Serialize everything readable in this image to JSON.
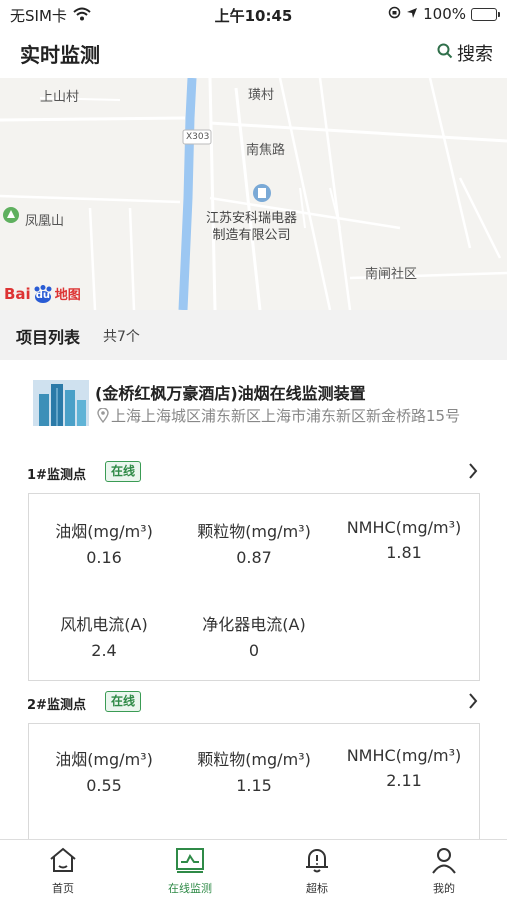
{
  "status_bar": {
    "carrier": "无SIM卡",
    "time": "上午10:45",
    "battery_percent": "100%",
    "battery_color": "#4cd964"
  },
  "nav": {
    "title": "实时监测",
    "search_label": "搜索",
    "search_icon": "search-icon"
  },
  "map": {
    "labels": {
      "shangshancun": "上山村",
      "huangcun": "璜村",
      "road_code": "X303",
      "nanjiao_road": "南焦路",
      "fenghuangshan": "凤凰山",
      "poi_line1": "江苏安科瑞电器",
      "poi_line2": "制造有限公司",
      "nanzha_community": "南闸社区"
    },
    "logo": {
      "bai": "Bai",
      "du": "du",
      "ditu": "地图"
    }
  },
  "project_list": {
    "title": "项目列表",
    "count": "共7个"
  },
  "project": {
    "name": "(金桥红枫万豪酒店)油烟在线监测装置",
    "address": "上海上海城区浦东新区上海市浦东新区新金桥路15号",
    "points": [
      {
        "name": "1#监测点",
        "status": "在线",
        "metrics": [
          {
            "label": "油烟(mg/m³)",
            "value": "0.16"
          },
          {
            "label": "颗粒物(mg/m³)",
            "value": "0.87"
          },
          {
            "label": "NMHC(mg/m³)",
            "value": "1.81"
          },
          {
            "label": "风机电流(A)",
            "value": "2.4"
          },
          {
            "label": "净化器电流(A)",
            "value": "0"
          }
        ]
      },
      {
        "name": "2#监测点",
        "status": "在线",
        "metrics": [
          {
            "label": "油烟(mg/m³)",
            "value": "0.55"
          },
          {
            "label": "颗粒物(mg/m³)",
            "value": "1.15"
          },
          {
            "label": "NMHC(mg/m³)",
            "value": "2.11"
          }
        ]
      }
    ]
  },
  "tabbar": {
    "items": [
      {
        "label": "首页",
        "icon": "home-icon"
      },
      {
        "label": "在线监测",
        "icon": "monitor-icon",
        "active": true
      },
      {
        "label": "超标",
        "icon": "alarm-bell-icon"
      },
      {
        "label": "我的",
        "icon": "user-icon"
      }
    ],
    "active_color": "#2f8a47"
  }
}
